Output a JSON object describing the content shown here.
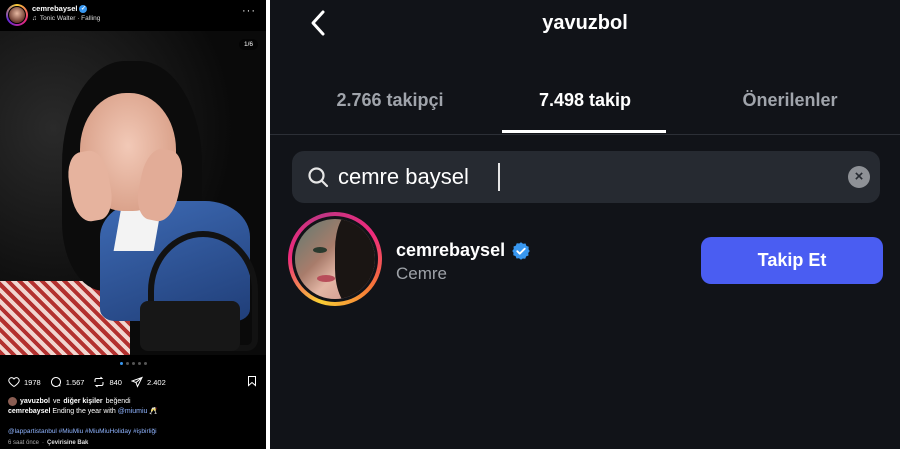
{
  "post": {
    "username": "cemrebaysel",
    "music": "Tonic Walter · Falling",
    "more": "···",
    "photo_counter": "1/6",
    "carousel": {
      "count": 5,
      "active": 0
    },
    "likes_count": "1978",
    "comments_count": "1.567",
    "reposts_count": "840",
    "shares_count": "2.402",
    "liked_by_user": "yavuzbol",
    "liked_by_mid": "ve",
    "liked_by_others": "diğer kişiler",
    "liked_by_suffix": "beğendi",
    "caption_user": "cemrebaysel",
    "caption_text": "Ending the year with",
    "caption_mention": "@miumiu",
    "caption_emoji": "🥂",
    "hashtags": "@lappartistanbul #MiuMiu #MiuMiuHoliday #işbirliği",
    "time_ago": "6 saat önce",
    "separator": "·",
    "translate_label": "Çevirisine Bak"
  },
  "following": {
    "title": "yavuzbol",
    "tabs": [
      {
        "label": "2.766 takipçi",
        "active": false
      },
      {
        "label": "7.498 takip",
        "active": true
      },
      {
        "label": "Önerilenler",
        "active": false
      }
    ],
    "search": {
      "value": "cemre baysel"
    },
    "result": {
      "username": "cemrebaysel",
      "full_name": "Cemre",
      "verified": true,
      "follow_label": "Takip Et"
    }
  },
  "colors": {
    "accent_blue": "#4a5df2",
    "verified_blue": "#3897f0",
    "right_bg": "#111318",
    "search_bg": "#262a31"
  }
}
